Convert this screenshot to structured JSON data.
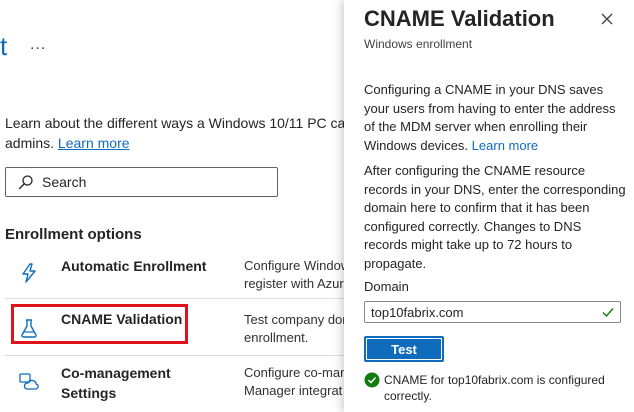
{
  "background": {
    "title_fragment": "t",
    "more_label": "...",
    "intro_text": "Learn about the different ways a Windows 10/11 PC can",
    "intro_text_line2": "admins.",
    "learn_more": "Learn more",
    "search": {
      "placeholder": "Search"
    },
    "section_title": "Enrollment options",
    "options": [
      {
        "name": "Automatic Enrollment",
        "desc_line1": "Configure Window",
        "desc_line2": "register with Azur",
        "icon": "lightning-icon"
      },
      {
        "name": "CNAME Validation",
        "desc_line1": "Test company dom",
        "desc_line2": "enrollment.",
        "icon": "flask-icon"
      },
      {
        "name_line1": "Co-management",
        "name_line2": "Settings",
        "desc_line1": "Configure co-mana",
        "desc_line2": "Manager integrat",
        "icon": "co-management-icon"
      }
    ]
  },
  "panel": {
    "title": "CNAME Validation",
    "subtitle": "Windows enrollment",
    "para1": "Configuring a CNAME in your DNS saves your users from having to enter the address of the MDM server when enrolling their Windows devices.",
    "para1_link": "Learn more",
    "para2": "After configuring the CNAME resource records in your DNS, enter the corresponding domain here to confirm that it has been configured correctly. Changes to DNS records might take up to 72 hours to propagate.",
    "domain_label": "Domain",
    "domain_value": "top10fabrix.com",
    "test_button": "Test",
    "status_text": "CNAME for top10fabrix.com is configured correctly."
  },
  "colors": {
    "accent": "#0f6cbd",
    "success": "#107c10",
    "highlight": "#e0121b"
  }
}
